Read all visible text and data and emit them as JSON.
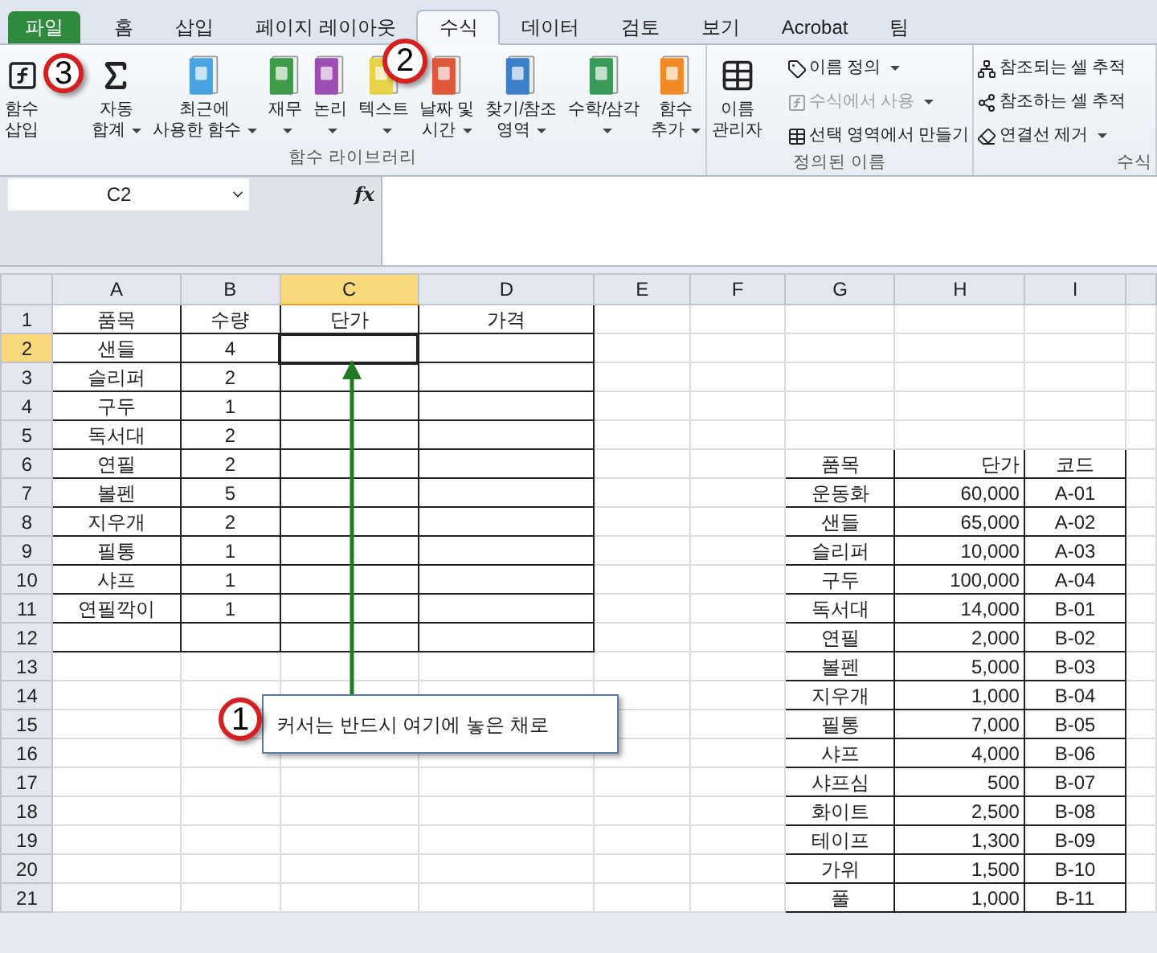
{
  "tabs": [
    {
      "label": "파일",
      "kind": "file",
      "selected": false
    },
    {
      "label": "홈",
      "kind": "tab",
      "selected": false
    },
    {
      "label": "삽입",
      "kind": "tab",
      "selected": false
    },
    {
      "label": "페이지 레이아웃",
      "kind": "tab",
      "selected": false
    },
    {
      "label": "수식",
      "kind": "tab",
      "selected": true
    },
    {
      "label": "데이터",
      "kind": "tab",
      "selected": false
    },
    {
      "label": "검토",
      "kind": "tab",
      "selected": false
    },
    {
      "label": "보기",
      "kind": "tab",
      "selected": false
    },
    {
      "label": "Acrobat",
      "kind": "tab",
      "selected": false
    },
    {
      "label": "팀",
      "kind": "tab",
      "selected": false
    }
  ],
  "ribbon": {
    "groups": [
      {
        "label": "함수 라이브러리",
        "kind": "large",
        "buttons": [
          {
            "lines": [
              "함수",
              "삽입"
            ],
            "kind": "function",
            "dropdown": false
          },
          {
            "lines": [
              "자동",
              "합계"
            ],
            "kind": "sum",
            "dropdown": true
          },
          {
            "lines": [
              "최근에",
              "사용한 함수"
            ],
            "kind": "category",
            "color": "#4aa3df",
            "dropdown": true
          },
          {
            "lines": [
              "재무"
            ],
            "kind": "category",
            "color": "#3f9a4a",
            "dropdown": true
          },
          {
            "lines": [
              "논리"
            ],
            "kind": "category",
            "color": "#9b4fb3",
            "dropdown": true
          },
          {
            "lines": [
              "텍스트"
            ],
            "kind": "category",
            "color": "#e8d24a",
            "dropdown": true
          },
          {
            "lines": [
              "날짜 및",
              "시간"
            ],
            "kind": "category",
            "color": "#e0583a",
            "dropdown": true
          },
          {
            "lines": [
              "찾기/참조",
              "영역"
            ],
            "kind": "category",
            "color": "#3d7fc8",
            "dropdown": true
          },
          {
            "lines": [
              "수학/삼각"
            ],
            "kind": "category",
            "color": "#3a9a5a",
            "dropdown": true
          },
          {
            "lines": [
              "함수",
              "추가"
            ],
            "kind": "category",
            "color": "#f08a24",
            "dropdown": true
          }
        ]
      },
      {
        "label": "정의된 이름",
        "kind": "names",
        "big": {
          "lines": [
            "이름",
            "관리자"
          ]
        },
        "items": [
          {
            "label": "이름 정의",
            "dropdown": true,
            "disabled": false
          },
          {
            "label": "수식에서 사용",
            "dropdown": true,
            "disabled": true
          },
          {
            "label": "선택 영역에서 만들기",
            "dropdown": false,
            "disabled": false
          }
        ]
      },
      {
        "label": "수식",
        "kind": "audit",
        "items": [
          {
            "label": "참조되는 셀 추적",
            "dropdown": false,
            "disabled": false
          },
          {
            "label": "참조하는 셀 추적",
            "dropdown": false,
            "disabled": false
          },
          {
            "label": "연결선 제거",
            "dropdown": true,
            "disabled": false
          }
        ]
      }
    ]
  },
  "formula_bar": {
    "name_box": "C2",
    "fx_label": "fx"
  },
  "columns": [
    {
      "label": "A",
      "selected": false
    },
    {
      "label": "B",
      "selected": false
    },
    {
      "label": "C",
      "selected": true
    },
    {
      "label": "D",
      "selected": false
    },
    {
      "label": "E",
      "selected": false
    },
    {
      "label": "F",
      "selected": false
    },
    {
      "label": "G",
      "selected": false
    },
    {
      "label": "H",
      "selected": false
    },
    {
      "label": "I",
      "selected": false
    }
  ],
  "rows": [
    {
      "number": "1",
      "selected": false,
      "cells": {
        "A": "품목",
        "B": "수량",
        "C": "단가",
        "D": "가격"
      }
    },
    {
      "number": "2",
      "selected": true,
      "cells": {
        "A": "샌들",
        "B": "4"
      }
    },
    {
      "number": "3",
      "selected": false,
      "cells": {
        "A": "슬리퍼",
        "B": "2"
      }
    },
    {
      "number": "4",
      "selected": false,
      "cells": {
        "A": "구두",
        "B": "1"
      }
    },
    {
      "number": "5",
      "selected": false,
      "cells": {
        "A": "독서대",
        "B": "2"
      }
    },
    {
      "number": "6",
      "selected": false,
      "cells": {
        "A": "연필",
        "B": "2",
        "G": "품목",
        "H": "단가",
        "I": "코드"
      }
    },
    {
      "number": "7",
      "selected": false,
      "cells": {
        "A": "볼펜",
        "B": "5",
        "G": "운동화",
        "H": "60,000",
        "I": "A-01"
      }
    },
    {
      "number": "8",
      "selected": false,
      "cells": {
        "A": "지우개",
        "B": "2",
        "G": "샌들",
        "H": "65,000",
        "I": "A-02"
      }
    },
    {
      "number": "9",
      "selected": false,
      "cells": {
        "A": "필통",
        "B": "1",
        "G": "슬리퍼",
        "H": "10,000",
        "I": "A-03"
      }
    },
    {
      "number": "10",
      "selected": false,
      "cells": {
        "A": "샤프",
        "B": "1",
        "G": "구두",
        "H": "100,000",
        "I": "A-04"
      }
    },
    {
      "number": "11",
      "selected": false,
      "cells": {
        "A": "연필깍이",
        "B": "1",
        "G": "독서대",
        "H": "14,000",
        "I": "B-01"
      }
    },
    {
      "number": "12",
      "selected": false,
      "cells": {
        "G": "연필",
        "H": "2,000",
        "I": "B-02"
      }
    },
    {
      "number": "13",
      "selected": false,
      "cells": {
        "G": "볼펜",
        "H": "5,000",
        "I": "B-03"
      }
    },
    {
      "number": "14",
      "selected": false,
      "cells": {
        "G": "지우개",
        "H": "1,000",
        "I": "B-04"
      }
    },
    {
      "number": "15",
      "selected": false,
      "cells": {
        "G": "필통",
        "H": "7,000",
        "I": "B-05"
      }
    },
    {
      "number": "16",
      "selected": false,
      "cells": {
        "G": "샤프",
        "H": "4,000",
        "I": "B-06"
      }
    },
    {
      "number": "17",
      "selected": false,
      "cells": {
        "G": "샤프심",
        "H": "500",
        "I": "B-07"
      }
    },
    {
      "number": "18",
      "selected": false,
      "cells": {
        "G": "화이트",
        "H": "2,500",
        "I": "B-08"
      }
    },
    {
      "number": "19",
      "selected": false,
      "cells": {
        "G": "테이프",
        "H": "1,300",
        "I": "B-09"
      }
    },
    {
      "number": "20",
      "selected": false,
      "cells": {
        "G": "가위",
        "H": "1,500",
        "I": "B-10"
      }
    },
    {
      "number": "21",
      "selected": false,
      "cells": {
        "G": "풀",
        "H": "1,000",
        "I": "B-11"
      }
    }
  ],
  "callout": {
    "number": "1",
    "text": "커서는 반드시 여기에 놓은 채로"
  },
  "markers": [
    {
      "number": "2",
      "kind": "tab"
    },
    {
      "number": "3",
      "kind": "button"
    }
  ]
}
